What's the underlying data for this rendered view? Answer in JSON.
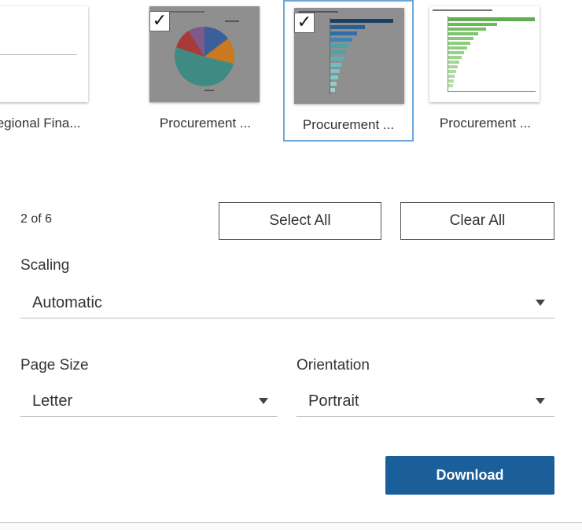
{
  "thumbnails": [
    {
      "label": "Regional Fina...",
      "selected": false,
      "checked": false
    },
    {
      "label": "Procurement ...",
      "selected": false,
      "checked": true
    },
    {
      "label": "Procurement ...",
      "selected": true,
      "checked": true
    },
    {
      "label": "Procurement ...",
      "selected": false,
      "checked": false
    }
  ],
  "selection": {
    "count_text": "2 of 6",
    "select_all_label": "Select All",
    "clear_all_label": "Clear All"
  },
  "scaling": {
    "label": "Scaling",
    "value": "Automatic"
  },
  "page_size": {
    "label": "Page Size",
    "value": "Letter"
  },
  "orientation": {
    "label": "Orientation",
    "value": "Portrait"
  },
  "download_label": "Download",
  "colors": {
    "accent": "#1a5e9a",
    "selected_border": "#6aa7d8",
    "bar_blue": "#2f6ea8",
    "bar_teal": "#4fa3a8",
    "bar_green": "#5fae4f"
  }
}
